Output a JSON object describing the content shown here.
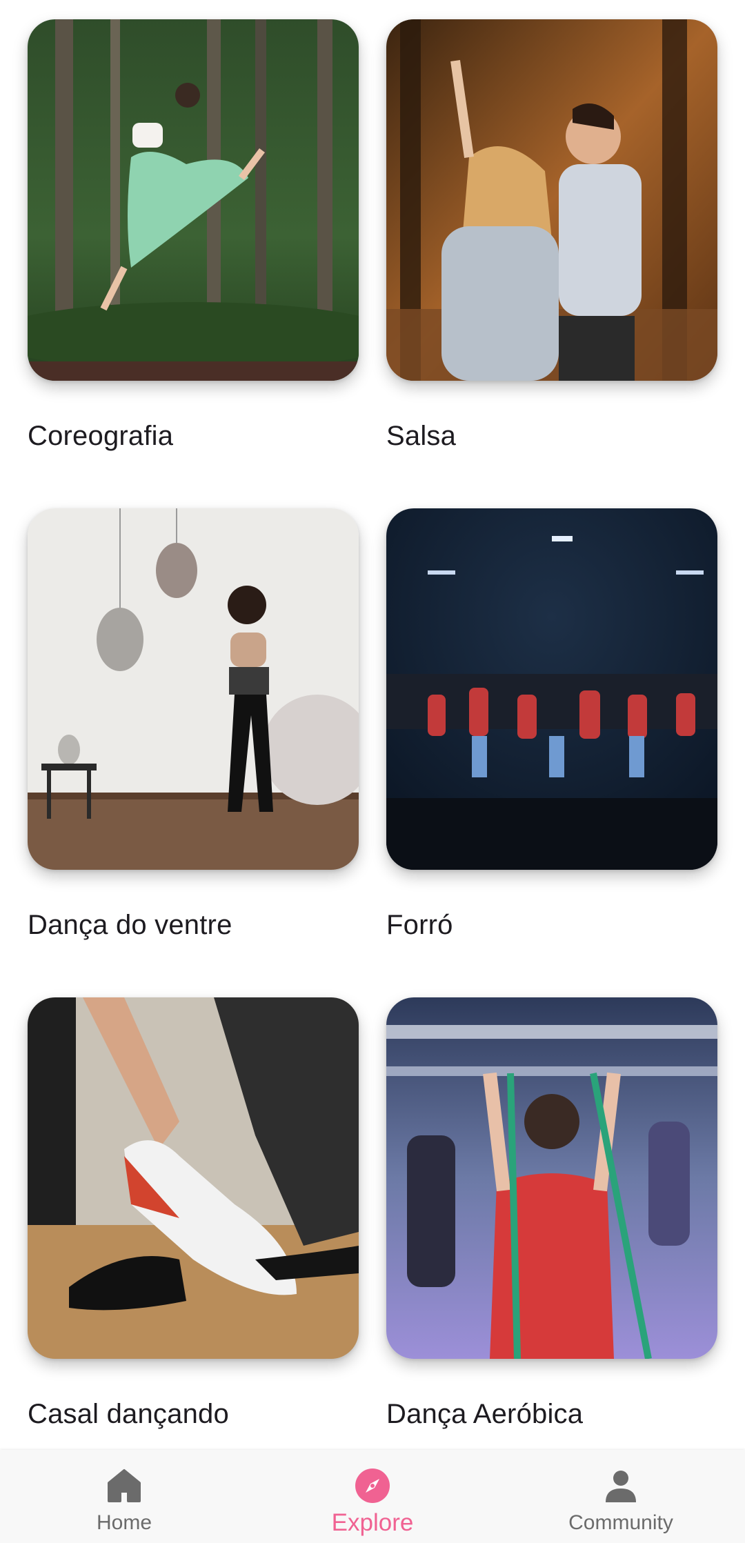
{
  "categories": [
    {
      "title": "Coreografia",
      "image": "dancer-leaping-in-forest"
    },
    {
      "title": "Salsa",
      "image": "couple-dancing-in-woods"
    },
    {
      "title": "Dança do ventre",
      "image": "belly-dancer-in-room"
    },
    {
      "title": "Forró",
      "image": "dance-group-on-stage"
    },
    {
      "title": "Casal dançando",
      "image": "couple-dance-shoes"
    },
    {
      "title": "Dança Aeróbica",
      "image": "aerobics-class-with-bands"
    }
  ],
  "bottom_nav": {
    "items": [
      {
        "label": "Home",
        "icon": "home-icon",
        "active": false
      },
      {
        "label": "Explore",
        "icon": "compass-icon",
        "active": true
      },
      {
        "label": "Community",
        "icon": "person-icon",
        "active": false
      }
    ]
  },
  "colors": {
    "accent": "#f06292",
    "inactive": "#6b6b6b",
    "text": "#1d1b20",
    "nav_background": "#f8f8f8"
  }
}
